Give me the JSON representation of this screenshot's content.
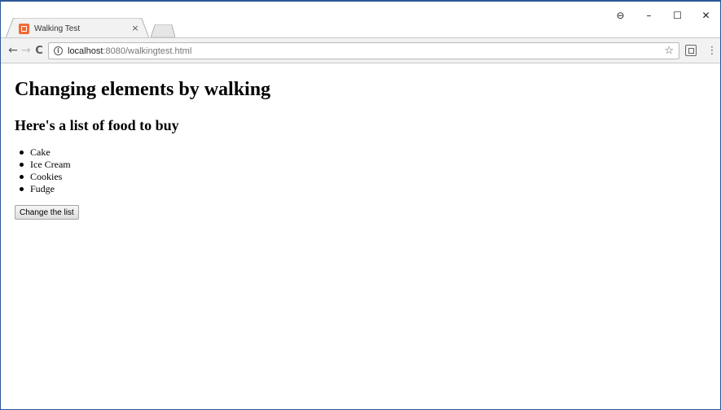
{
  "browser": {
    "tab_title": "Walking Test",
    "tab_close": "×",
    "url_host": "localhost",
    "url_path": ":8080/walkingtest.html",
    "controls": {
      "account": "⊖",
      "minimize": "–",
      "maximize": "☐",
      "close": "✕"
    },
    "nav": {
      "back": "←",
      "forward": "→",
      "reload": "C"
    },
    "info_icon": "i",
    "bookmark_star": "☆",
    "menu": "⋮",
    "icons": [
      "favicon-icon",
      "back-arrow-icon",
      "forward-arrow-icon",
      "reload-icon",
      "info-icon",
      "star-icon",
      "extension-icon",
      "menu-icon"
    ]
  },
  "page": {
    "heading": "Changing elements by walking",
    "subheading": "Here's a list of food to buy",
    "list": [
      "Cake",
      "Ice Cream",
      "Cookies",
      "Fudge"
    ],
    "button_label": "Change the list"
  },
  "colors": {
    "window_border": "#2b5797",
    "favicon": "#f06a35",
    "toolbar_bg": "#f2f2f2"
  }
}
